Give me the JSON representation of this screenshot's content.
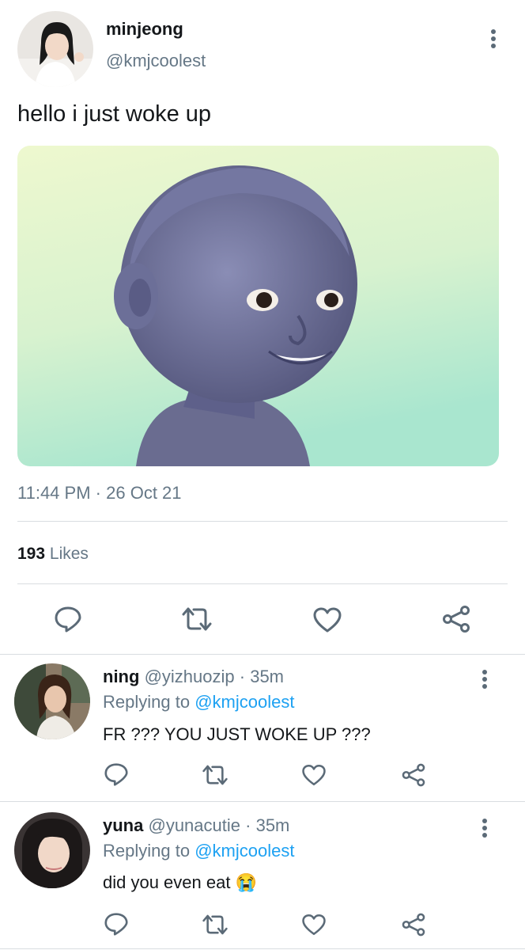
{
  "tweet": {
    "display_name": "minjeong",
    "handle": "@kmjcoolest",
    "text": "hello i just woke up",
    "time": "11:44 PM",
    "separator": "·",
    "date": "26 Oct 21",
    "likes_count": "193",
    "likes_label": "Likes"
  },
  "replies": [
    {
      "display_name": "ning",
      "handle": "@yizhuozip",
      "separator": "·",
      "age": "35m",
      "replying_to_label": "Replying to",
      "replying_to_handle": "@kmjcoolest",
      "text": "FR ??? YOU JUST WOKE UP ???"
    },
    {
      "display_name": "yuna",
      "handle": "@yunacutie",
      "separator": "·",
      "age": "35m",
      "replying_to_label": "Replying to",
      "replying_to_handle": "@kmjcoolest",
      "text": "did you even eat",
      "emoji": "😭"
    }
  ],
  "icons": {
    "reply": "comment-icon",
    "retweet": "retweet-icon",
    "like": "heart-icon",
    "share": "share-icon",
    "more": "more-vertical-icon"
  },
  "colors": {
    "link": "#1da1f2",
    "secondary_text": "#657786",
    "primary_text": "#14171a",
    "divider": "#d9dde1"
  }
}
